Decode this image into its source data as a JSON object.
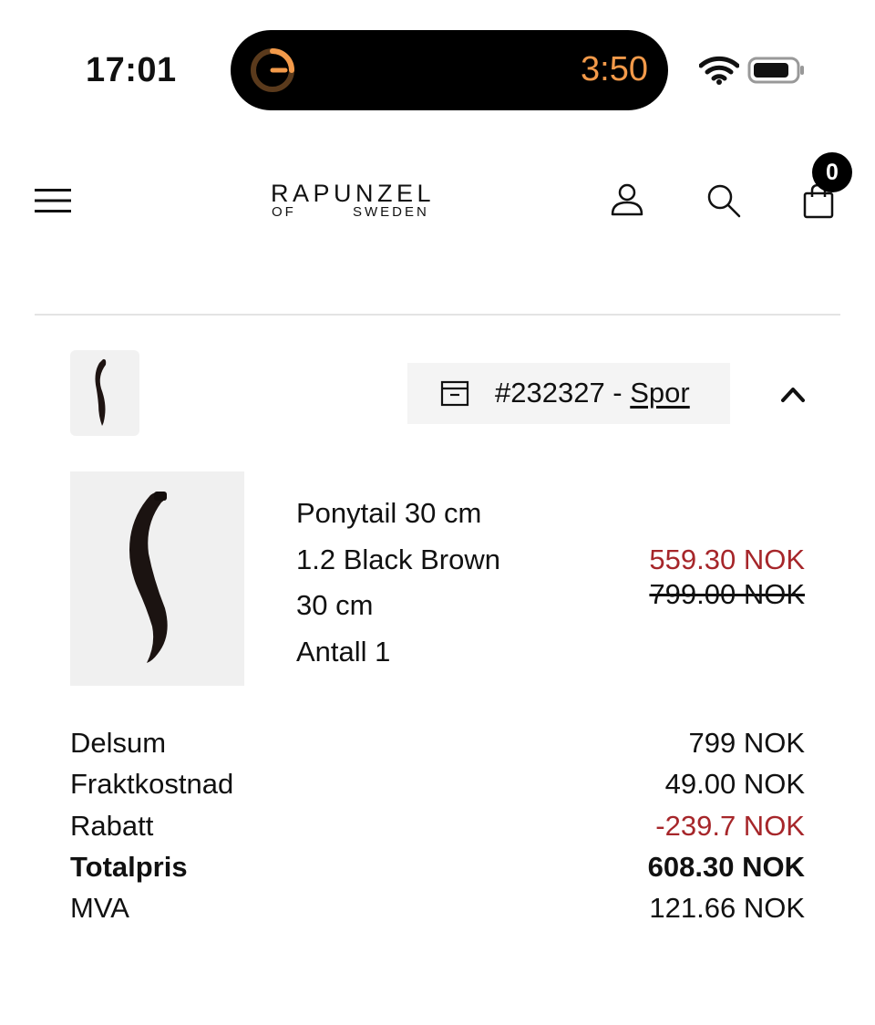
{
  "status_bar": {
    "time": "17:01",
    "timer": "3:50"
  },
  "header": {
    "logo_main": "RAPUNZEL",
    "logo_of": "OF",
    "logo_sweden": "SWEDEN",
    "cart_count": "0",
    "icons": [
      "menu-icon",
      "user-icon",
      "search-icon",
      "bag-icon"
    ]
  },
  "order": {
    "number": "#232327",
    "separator": " - ",
    "track_label": "Spor"
  },
  "product": {
    "name": "Ponytail 30 cm",
    "color": "1.2 Black Brown",
    "length": "30 cm",
    "quantity": "Antall 1",
    "price_now": "559.30 NOK",
    "price_was": "799.00 NOK"
  },
  "summary": {
    "rows": [
      {
        "label": "Delsum",
        "value": "799 NOK"
      },
      {
        "label": "Fraktkostnad",
        "value": "49.00 NOK"
      },
      {
        "label": "Rabatt",
        "value": "-239.7 NOK"
      },
      {
        "label": "Totalpris",
        "value": "608.30 NOK"
      },
      {
        "label": "MVA",
        "value": "121.66 NOK"
      }
    ]
  },
  "colors": {
    "sale_red": "#a6262a",
    "timer_orange": "#f39a4a",
    "tag_bg": "#f4f4f4"
  }
}
